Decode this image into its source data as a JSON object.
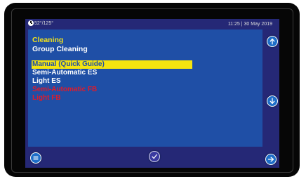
{
  "status": {
    "temperature": "52°/125°",
    "datetime": "11:25 | 30 May 2019"
  },
  "section": {
    "title": "Cleaning",
    "subtitle": "Group Cleaning"
  },
  "menu": {
    "items": [
      {
        "label": "Manual (Quick Guide)",
        "state": "selected"
      },
      {
        "label": "Semi-Automatic ES",
        "state": "enabled"
      },
      {
        "label": "Light ES",
        "state": "enabled"
      },
      {
        "label": "Semi-Automatic FB",
        "state": "disabled"
      },
      {
        "label": "Light FB",
        "state": "disabled"
      }
    ]
  },
  "buttons": {
    "up": "arrow-up-icon",
    "down": "arrow-down-icon",
    "menu": "menu-icon",
    "confirm": "checkmark-icon",
    "next": "arrow-right-icon"
  },
  "colors": {
    "panel": "#1f4fa6",
    "screen_bg": "#252876",
    "title": "#f2e21a",
    "selected_bg": "#f5e40f",
    "disabled_text": "#e01b2a"
  }
}
